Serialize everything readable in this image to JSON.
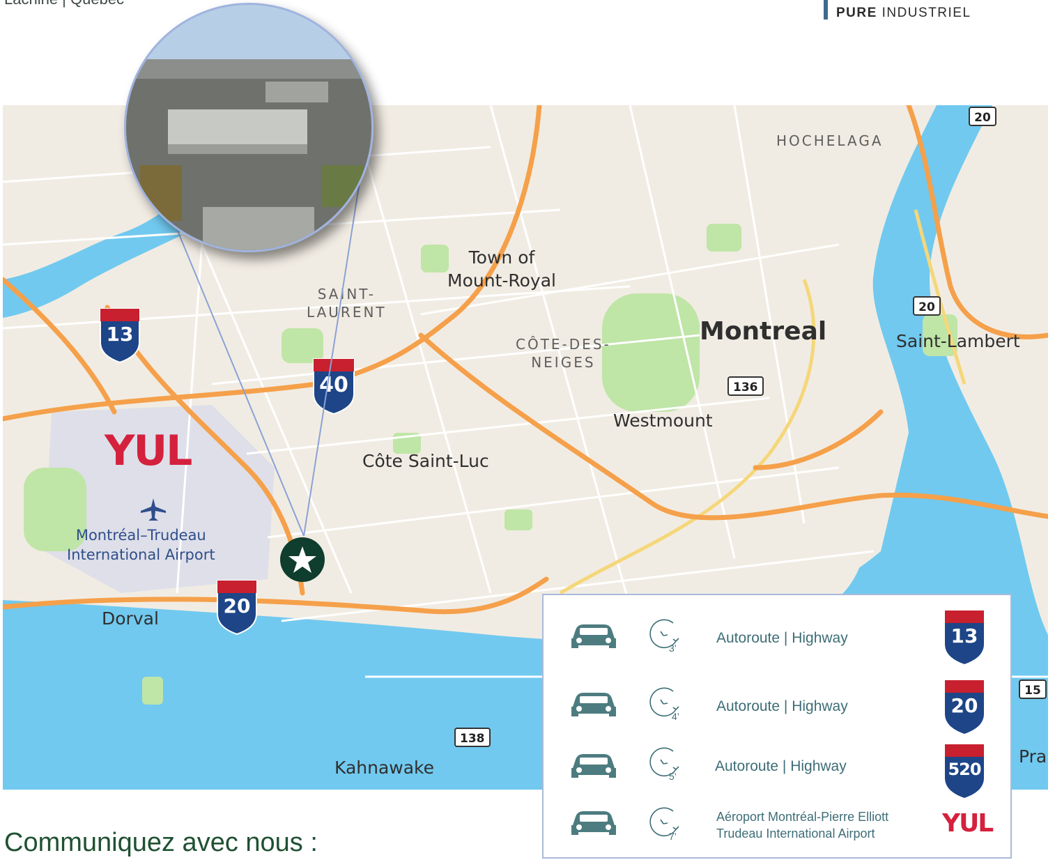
{
  "header": {
    "location": "Lachine | Québec",
    "brand_bold": "PURE",
    "brand_rest": " INDUSTRIEL"
  },
  "map": {
    "districts": [
      {
        "line1": "HOCHELAGA",
        "line2": ""
      },
      {
        "line1": "SAINT-",
        "line2": "LAURENT"
      },
      {
        "line1": "CÔTE-DES-",
        "line2": "NEIGES"
      }
    ],
    "cities": {
      "town_mount_royal_1": "Town of",
      "town_mount_royal_2": "Mount-Royal",
      "montreal": "Montreal",
      "saint_lambert": "Saint-Lambert",
      "westmount": "Westmount",
      "cote_saint_luc": "Côte Saint-Luc",
      "dorval": "Dorval",
      "kahnawake": "Kahnawake",
      "pra": "Pra",
      "airport_1": "Montréal–Trudeau",
      "airport_2": "International Airport"
    },
    "route_boxes": {
      "r20_top": "20",
      "r20_mid": "20",
      "r136": "136",
      "r138": "138",
      "r15": "15"
    },
    "shields": {
      "s13": "13",
      "s40": "40",
      "s20": "20"
    },
    "yul": "YUL",
    "colors": {
      "land": "#f1ece3",
      "water": "#71c9ef",
      "park": "#bfe5a7",
      "highway": "#f5a04a",
      "primary": "#f5d77a",
      "street": "#ffffff",
      "airport": "#dedfe9",
      "marker": "#0f3d2e",
      "shield_blue": "#1d4587",
      "shield_red": "#c8202f"
    },
    "marker_icon": "star-icon",
    "airport_icon": "airplane-icon"
  },
  "legend": {
    "rows": [
      {
        "minutes": "3’",
        "text": "Autoroute | Highway",
        "shield": "13"
      },
      {
        "minutes": "4’",
        "text": "Autoroute | Highway",
        "shield": "20"
      },
      {
        "minutes": "5’",
        "text": "Autoroute | Highway",
        "shield": "520"
      },
      {
        "minutes": "7’",
        "text1": "Aéroport Montréal-Pierre Elliott",
        "text2": "Trudeau International Airport",
        "logo": "YUL"
      }
    ]
  },
  "footer": {
    "contact_title": "Communiquez avec nous :"
  }
}
